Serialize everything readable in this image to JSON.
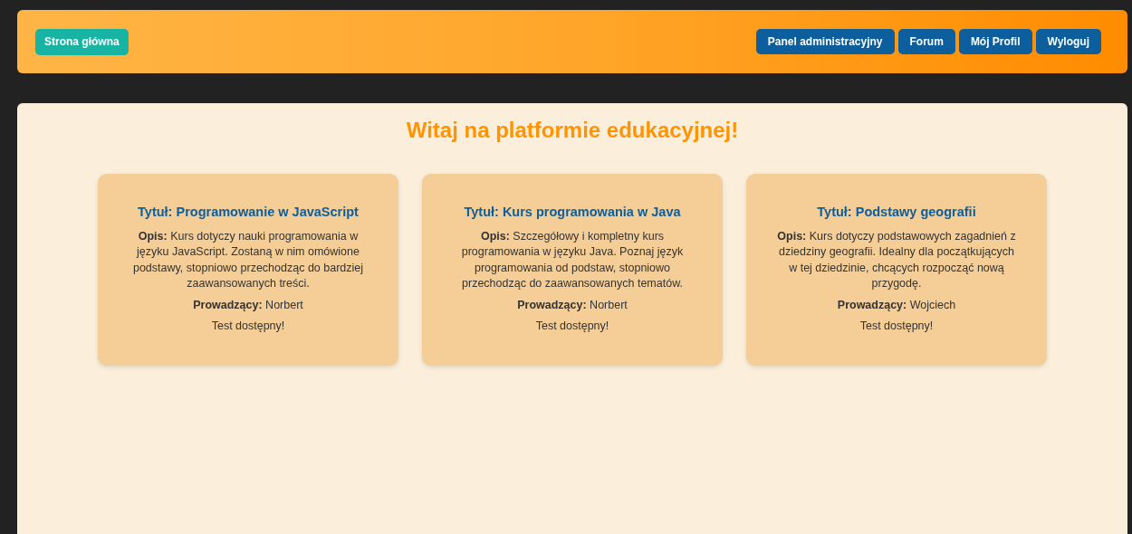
{
  "header": {
    "home_button": "Strona główna",
    "nav": [
      "Panel administracyjny",
      "Forum",
      "Mój Profil",
      "Wyloguj"
    ]
  },
  "heading": "Witaj na platformie edukacyjnej!",
  "courses": [
    {
      "title": "Tytuł: Programowanie w JavaScript",
      "description": "**Opis:** Kurs dotyczy nauki programowania w języku JavaScript. Zostaną w nim omówione podstawy, stopniowo przechodząc do bardziej zaawansowanych treści.",
      "teacher": "**Prowadzący:** Norbert",
      "status": "Test dostępny!"
    },
    {
      "title": "Tytuł: Kurs programowania w Java",
      "description": "**Opis:** Szczegółowy i kompletny kurs programowania w języku Java. Poznaj język programowania od podstaw, stopniowo przechodząc do zaawansowanych tematów.",
      "teacher": "**Prowadzący:** Norbert",
      "status": "Test dostępny!"
    },
    {
      "title": "Tytuł: Podstawy geografii",
      "description": "**Opis:** Kurs dotyczy podstawowych zagadnień z dziedziny geografii. Idealny dla początkujących w tej dziedzinie, chcących rozpocząć nową przygodę.",
      "teacher": "**Prowadzący:** Wojciech",
      "status": "Test dostępny!"
    }
  ]
}
